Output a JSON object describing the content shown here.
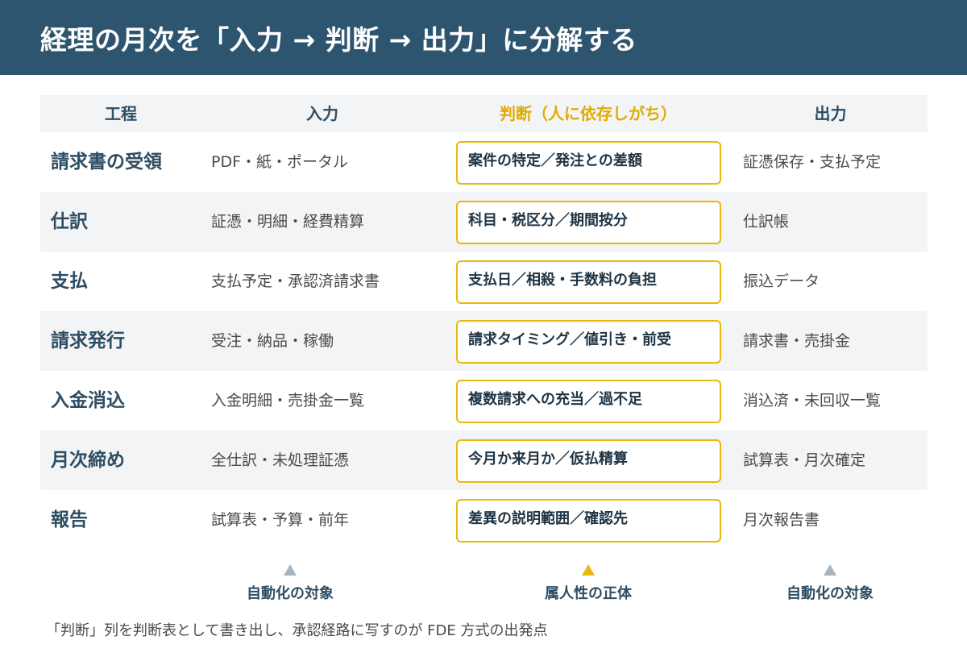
{
  "title": "経理の月次を「入力 → 判断 → 出力」に分解する",
  "headers": {
    "step": "工程",
    "input": "入力",
    "judgment": "判断（人に依存しがち）",
    "output": "出力"
  },
  "rows": [
    {
      "step": "請求書の受領",
      "input": "PDF・紙・ポータル",
      "judgment": "案件の特定／発注との差額",
      "output": "証憑保存・支払予定"
    },
    {
      "step": "仕訳",
      "input": "証憑・明細・経費精算",
      "judgment": "科目・税区分／期間按分",
      "output": "仕訳帳"
    },
    {
      "step": "支払",
      "input": "支払予定・承認済請求書",
      "judgment": "支払日／相殺・手数料の負担",
      "output": "振込データ"
    },
    {
      "step": "請求発行",
      "input": "受注・納品・稼働",
      "judgment": "請求タイミング／値引き・前受",
      "output": "請求書・売掛金"
    },
    {
      "step": "入金消込",
      "input": "入金明細・売掛金一覧",
      "judgment": "複数請求への充当／過不足",
      "output": "消込済・未回収一覧"
    },
    {
      "step": "月次締め",
      "input": "全仕訳・未処理証憑",
      "judgment": "今月か来月か／仮払精算",
      "output": "試算表・月次確定"
    },
    {
      "step": "報告",
      "input": "試算表・予算・前年",
      "judgment": "差異の説明範囲／確認先",
      "output": "月次報告書"
    }
  ],
  "markers": {
    "input": "自動化の対象",
    "judgment": "属人性の正体",
    "output": "自動化の対象"
  },
  "footnote": "「判断」列を判断表として書き出し、承認経路に写すのが FDE 方式の出発点",
  "colors": {
    "title_bg": "#2e5570",
    "accent": "#e8b80c",
    "row_shade": "#f2f4f6",
    "heading_text": "#2e4d63"
  }
}
